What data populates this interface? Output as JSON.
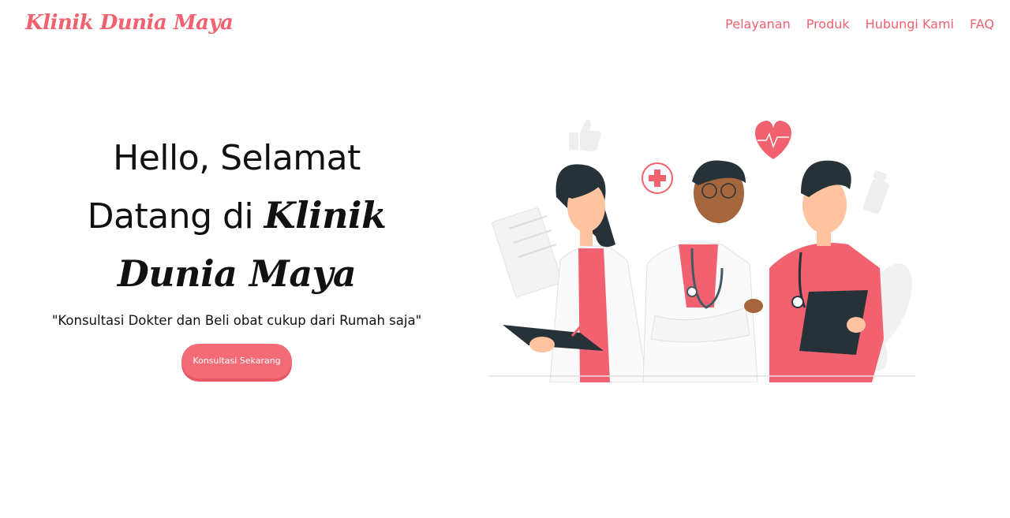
{
  "brand": {
    "name": "Klinik Dunia Maya"
  },
  "nav": {
    "items": [
      {
        "label": "Pelayanan"
      },
      {
        "label": "Produk"
      },
      {
        "label": "Hubungi Kami"
      },
      {
        "label": "FAQ"
      }
    ]
  },
  "hero": {
    "title_line1": "Hello, Selamat",
    "title_line2_prefix": "Datang di",
    "title_brand": "Klinik Dunia Maya",
    "tagline": "\"Konsultasi Dokter dan Beli obat cukup dari Rumah saja\"",
    "cta_label": "Konsultasi Sekarang"
  },
  "colors": {
    "accent": "#f2616f",
    "button": "#f36b77",
    "text": "#111111",
    "illustration_dark": "#263238"
  },
  "illustration": {
    "icons": [
      "thumbs-up-icon",
      "medical-cross-icon",
      "heart-pulse-icon",
      "pill-bottle-icon",
      "clipboard-icon"
    ]
  }
}
